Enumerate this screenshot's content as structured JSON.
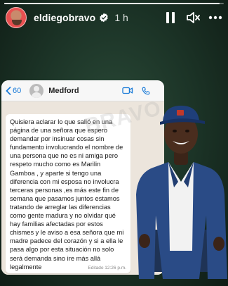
{
  "story": {
    "username": "eldiegobravo",
    "time": "1 h",
    "progress": 0.98
  },
  "chat": {
    "back_count": "60",
    "contact_name": "Medford",
    "message": "Quisiera aclarar lo que salió en una página de una señora que espero demandar por insinuar cosas sin fundamento involucrando el nombre de una persona que no es ni amiga pero respeto mucho como es Marilin Gamboa , y aparte si tengo una diferencia con mi esposa no involucra terceras personas ,es más este fin de semana que pasamos juntos estamos tratando de arreglar las diferencias como gente madura y no olvidar qué hay familias afectadas por estos chismes y le aviso a esa señora que mi madre padece del corazón y si a ella le pasa algo por esta situación no solo será demanda sino ire más allá legalmente",
    "meta": "Editado 12:26 p.m."
  },
  "watermark": "BRAVO",
  "icons": {
    "verified": "verified-badge-icon",
    "pause": "pause-icon",
    "mute": "speaker-muted-icon",
    "more": "more-horizontal-icon",
    "back": "chevron-left-icon",
    "video": "video-camera-icon",
    "phone": "phone-icon"
  },
  "colors": {
    "accent": "#1a7bd8",
    "background": "#1c3427"
  }
}
